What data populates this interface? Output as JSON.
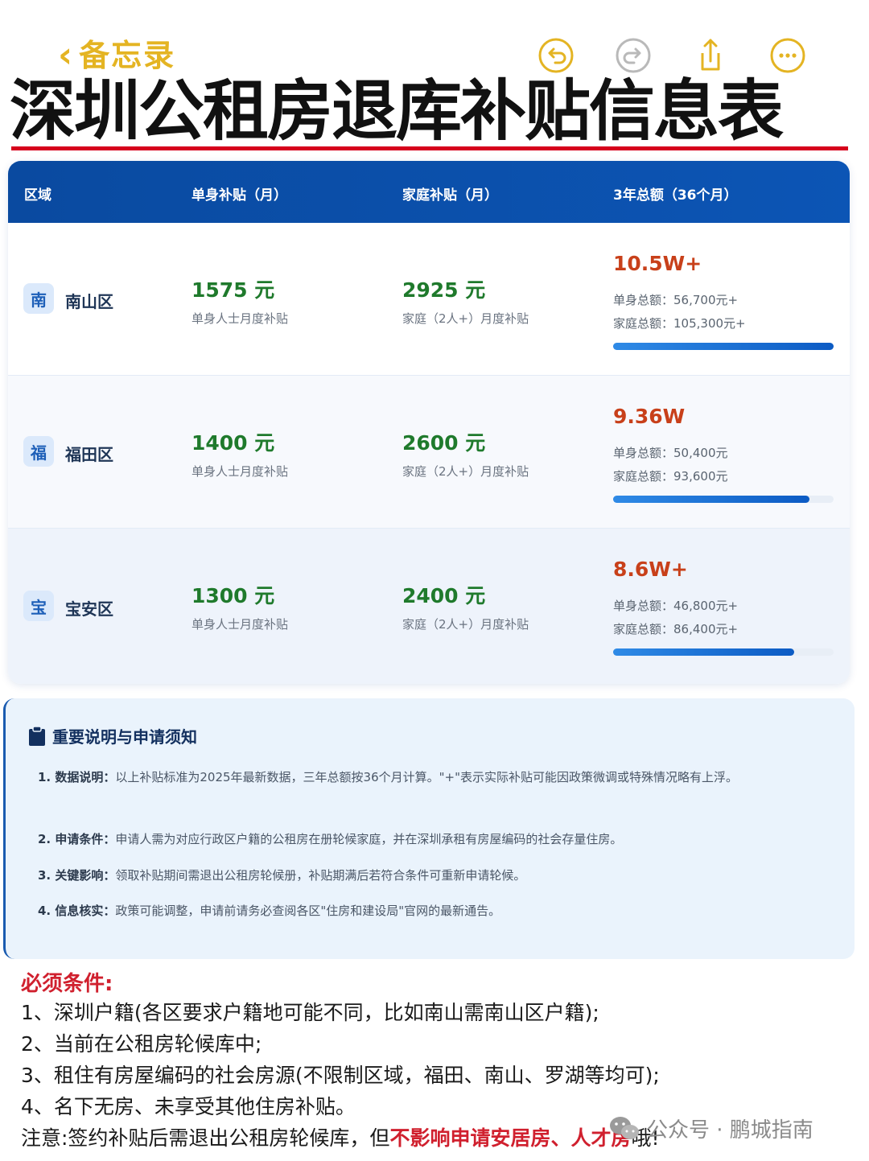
{
  "topbar": {
    "back_label": "备忘录",
    "back_icon": "chevron-left-icon",
    "icons": [
      "undo-icon",
      "redo-icon",
      "share-icon",
      "more-icon"
    ],
    "accent_color": "#e4b423"
  },
  "title": "深圳公租房退库补贴信息表",
  "table": {
    "headers": [
      "区域",
      "单身补贴（月）",
      "家庭补贴（月）",
      "3年总额（36个月）"
    ],
    "rows": [
      {
        "badge": "南",
        "district": "南山区",
        "single_amount": "1575 元",
        "single_note": "单身人士月度补贴",
        "family_amount": "2925 元",
        "family_note": "家庭（2人+）月度补贴",
        "total": "10.5W+",
        "single_total": "单身总额：56,700元+",
        "family_total": "家庭总额：105,300元+",
        "progress": 1.0
      },
      {
        "badge": "福",
        "district": "福田区",
        "single_amount": "1400 元",
        "single_note": "单身人士月度补贴",
        "family_amount": "2600 元",
        "family_note": "家庭（2人+）月度补贴",
        "total": "9.36W",
        "single_total": "单身总额：50,400元",
        "family_total": "家庭总额：93,600元",
        "progress": 0.89
      },
      {
        "badge": "宝",
        "district": "宝安区",
        "single_amount": "1300 元",
        "single_note": "单身人士月度补贴",
        "family_amount": "2400 元",
        "family_note": "家庭（2人+）月度补贴",
        "total": "8.6W+",
        "single_total": "单身总额：46,800元+",
        "family_total": "家庭总额：86,400元+",
        "progress": 0.82
      }
    ]
  },
  "notice": {
    "heading": "重要说明与申请须知",
    "items": [
      {
        "label": "1. 数据说明：",
        "text": "以上补贴标准为2025年最新数据，三年总额按36个月计算。\"+\"表示实际补贴可能因政策微调或特殊情况略有上浮。"
      },
      {
        "label": "2. 申请条件：",
        "text": "申请人需为对应行政区户籍的公租房在册轮候家庭，并在深圳承租有房屋编码的社会存量住房。"
      },
      {
        "label": "3. 关键影响：",
        "text": "领取补贴期间需退出公租房轮候册，补贴期满后若符合条件可重新申请轮候。"
      },
      {
        "label": "4. 信息核实：",
        "text": "政策可能调整，申请前请务必查阅各区\"住房和建设局\"官网的最新通告。"
      }
    ]
  },
  "requirements": {
    "title": "必须条件:",
    "lines": [
      "1、深圳户籍(各区要求户籍地可能不同，比如南山需南山区户籍);",
      "2、当前在公租房轮候库中;",
      "3、租住有房屋编码的社会房源(不限制区域，福田、南山、罗湖等均可);",
      "4、名下无房、未享受其他住房补贴。"
    ],
    "note_prefix": "注意:签约补贴后需退出公租房轮候库，但",
    "note_highlight": "不影响申请安居房、人才房",
    "note_suffix": "哦!"
  },
  "watermark": {
    "icon": "wechat-icon",
    "text": "公众号 · 鹏城指南"
  }
}
